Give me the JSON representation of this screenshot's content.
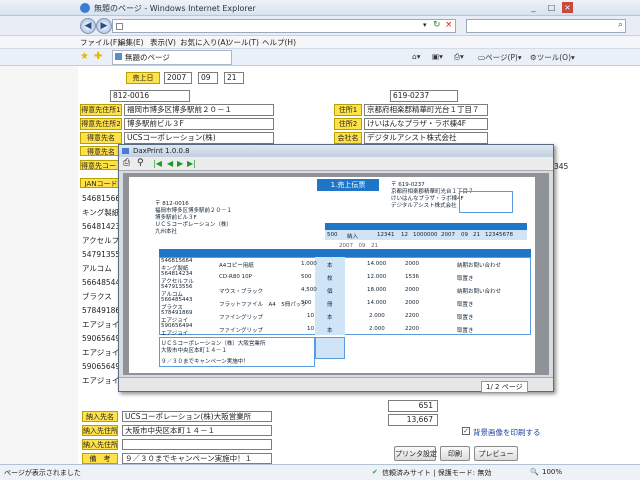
{
  "window": {
    "title": "無題のページ - Windows Internet Explorer",
    "search_icon": "magnifier-icon"
  },
  "addressbar": {
    "url": "",
    "refresh": "↻",
    "stop": "×",
    "back": "◀",
    "forward": "▶"
  },
  "menubar": {
    "items": [
      "ファイル(F)",
      "編集(E)",
      "表示(V)",
      "お気に入り(A)",
      "ツール(T)",
      "ヘルプ(H)"
    ]
  },
  "favbar": {
    "tab_title": "無題のページ",
    "page": "ページ(P)",
    "tools": "ツール(O)"
  },
  "form": {
    "sales_date_label": "売上日",
    "sales_year": "2007",
    "sales_month": "09",
    "sales_day": "21",
    "left": {
      "postal": "812-0016",
      "addr1_label": "得意先住所1",
      "addr1": "福岡市博多区博多駅前２０－１",
      "addr2_label": "得意先住所2",
      "addr2": "博多駅前ビル３F",
      "name_label": "得意先名",
      "name": "UCSコーポレーション(株)",
      "label4": "得意先名",
      "label5": "得意先コード",
      "jan_label": "JANコード"
    },
    "right": {
      "postal": "619-0237",
      "addr1_label": "住所1",
      "addr1": "京都府相楽郡精華町光台１丁目７",
      "addr2_label": "住所2",
      "addr2": "けいはんなプラザ・ラボ棟4F",
      "name_label": "会社名",
      "name": "デジタルアシスト株式会社",
      "code_end": "345"
    },
    "left_rows": [
      "546815664",
      "キング製紙",
      "564814234",
      "アクセルフ",
      "547913556",
      "アルコム",
      "566485443",
      "ブラクス",
      "578491869",
      "エアジョイ",
      "590656494",
      "エアジョイ",
      "590656494",
      "エアジョイ"
    ],
    "total1": "651",
    "total2": "13,667",
    "checkbox_label": "背景画像を印刷する",
    "dest_name_label": "納入先名",
    "dest_name": "UCSコーポレーション(株)大阪営業所",
    "dest_addr1_label": "納入先住所1",
    "dest_addr1": "大阪市中央区本町１４－１",
    "dest_addr2_label": "納入先住所2",
    "dest_addr2": "",
    "remarks_label": "備　考",
    "remarks": "９／３０までキャンペーン実施中！１",
    "btn_print_setup": "プリンタ設定",
    "btn_print": "印刷",
    "btn_preview": "プレビュー"
  },
  "dax": {
    "title": "DaxPrint 1.0.0.8",
    "toolbar_icons": [
      "print-icon",
      "zoom-icon",
      "first-page-icon",
      "prev-page-icon",
      "next-page-icon",
      "last-page-icon"
    ],
    "page_status": "1/ 2 ページ",
    "slip": {
      "header": "1.売上伝票",
      "left_postal": "〒 812-0016",
      "left_addr1": "福岡市博多区博多駅前２０－１",
      "left_addr2": "博多駅前ビル３F",
      "left_name": "ＵＣＳコーポレーション（株）",
      "left_sama": "九州本社",
      "right_postal": "〒 619-0237",
      "right_addr1": "京都府相楽郡精華町光台１丁目７",
      "right_addr2": "けいはんなプラザ・ラボ棟4F",
      "right_name": "デジタルアシスト株式会社",
      "date": "2007　09　21",
      "code_row": [
        "500",
        "納入",
        "12341",
        "12",
        "1000000",
        "2007",
        "09",
        "21",
        "12345678",
        ""
      ],
      "rows": [
        {
          "jan": "546815664",
          "item": "キング製紙",
          "spec": "A4コピー用紙",
          "qty": "1,000",
          "unit": "本",
          "price": "14.000",
          "amount": "2000",
          "note": "納期お問い合わせ"
        },
        {
          "jan": "564814234",
          "item": "アクセルフル",
          "spec": "CD-R80 10P",
          "qty": "500",
          "unit": "枚",
          "price": "12.000",
          "amount": "1536",
          "note": "取置き"
        },
        {
          "jan": "547913556",
          "item": "アルコム",
          "spec": "マウス・ブラック",
          "qty": "4,500",
          "unit": "個",
          "price": "18.000",
          "amount": "2000",
          "note": "納期お問い合わせ"
        },
        {
          "jan": "566485443",
          "item": "ブラクス",
          "spec": "フラットファイル　A4　5冊パック",
          "qty": "500",
          "unit": "冊",
          "price": "14.000",
          "amount": "2000",
          "note": "取置き"
        },
        {
          "jan": "578491869",
          "item": "エアジョイ",
          "spec": "ファイングリップ",
          "qty": "10",
          "unit": "本",
          "price": "2.000",
          "amount": "2200",
          "note": "取置き"
        },
        {
          "jan": "590656494",
          "item": "エアジョイ",
          "spec": "ファイングリップ",
          "qty": "10",
          "unit": "本",
          "price": "2.000",
          "amount": "2200",
          "note": "取置き"
        }
      ],
      "dest": "ＵＣＳコーポレーション（株）大阪営業所",
      "dest_addr": "大阪市中央区本町１４－１",
      "remark": "９／３０までキャンペーン実施中！"
    }
  },
  "status": {
    "left": "ページが表示されました",
    "trusted": "信頼済みサイト | 保護モード: 無効",
    "zoom": "100%"
  },
  "colors": {
    "label_yellow": "#ffe14a",
    "slip_blue": "#1f76c9",
    "accent": "#2ea043"
  }
}
